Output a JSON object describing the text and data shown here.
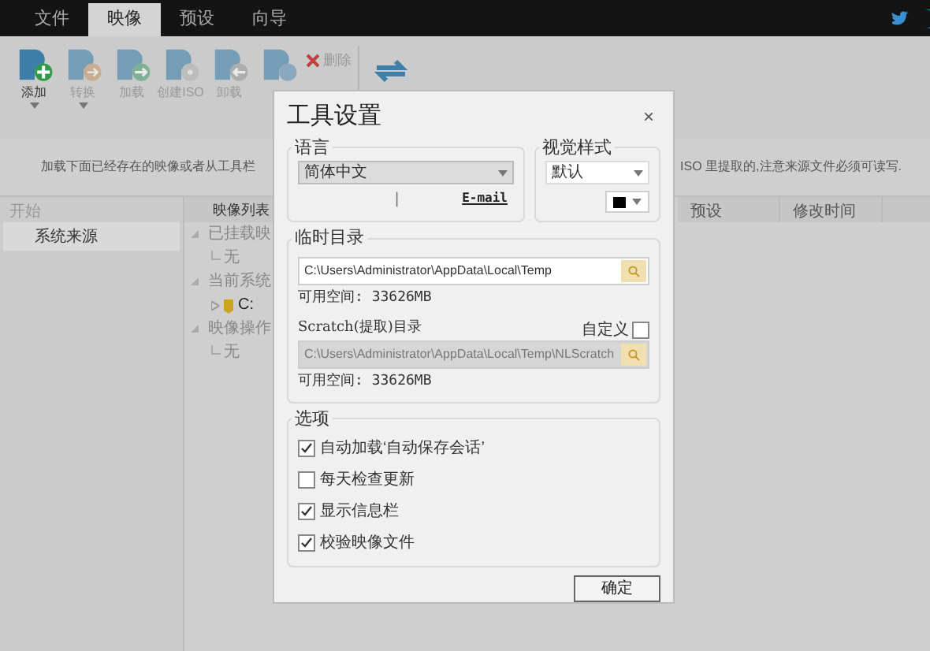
{
  "menu_tabs": [
    {
      "label": "文件",
      "selected": false
    },
    {
      "label": "映像",
      "selected": true
    },
    {
      "label": "预设",
      "selected": false
    },
    {
      "label": "向导",
      "selected": false
    }
  ],
  "toolbar": {
    "buttons": [
      {
        "label": "添加",
        "kind": "add",
        "dropdown": true,
        "disabled": false
      },
      {
        "label": "转换",
        "kind": "convert",
        "dropdown": true,
        "disabled": true
      },
      {
        "label": "加载",
        "kind": "mount",
        "dropdown": false,
        "disabled": true
      },
      {
        "label": "创建ISO",
        "kind": "disc",
        "dropdown": false,
        "disabled": true
      },
      {
        "label": "卸载",
        "kind": "unmount",
        "dropdown": false,
        "disabled": true
      },
      {
        "kind": "new",
        "dropdown": false,
        "disabled": true
      }
    ],
    "delete_label": "删除"
  },
  "info_left": "加载下面已经存在的映像或者从工具栏",
  "info_right": "ISO 里提取的,注意来源文件必须可读写.",
  "sidebar": {
    "header": "开始",
    "items": [
      {
        "label": "系统来源",
        "selected": true
      }
    ]
  },
  "image_list": {
    "header": "映像列表",
    "tree": [
      {
        "label": "已挂载映",
        "children": [
          {
            "label": "无",
            "kind": "text"
          }
        ]
      },
      {
        "label": "当前系统",
        "children": [
          {
            "label": "C:",
            "kind": "drive"
          }
        ]
      },
      {
        "label": "映像操作",
        "children": [
          {
            "label": "无",
            "kind": "text"
          }
        ]
      }
    ]
  },
  "columns": [
    "预设",
    "修改时间"
  ],
  "dialog": {
    "title": "工具设置",
    "close": "×",
    "language": {
      "legend": "语言",
      "value": "简体中文",
      "separator": "|",
      "link": "E-mail"
    },
    "visual_style": {
      "legend": "视觉样式",
      "value": "默认",
      "color": "#000000"
    },
    "temp": {
      "legend": "临时目录",
      "path": "C:\\Users\\Administrator\\AppData\\Local\\Temp",
      "free": "可用空间: 33626MB",
      "scratch_label": "Scratch(提取)目录",
      "custom_label": "自定义",
      "custom_checked": false,
      "scratch_path": "C:\\Users\\Administrator\\AppData\\Local\\Temp\\NLScratch",
      "scratch_disabled": true,
      "scratch_free": "可用空间: 33626MB"
    },
    "options": {
      "legend": "选项",
      "items": [
        {
          "label": "自动加载‘自动保存会话’",
          "checked": true
        },
        {
          "label": "每天检查更新",
          "checked": false
        },
        {
          "label": "显示信息栏",
          "checked": true
        },
        {
          "label": "校验映像文件",
          "checked": true
        }
      ]
    },
    "ok": "确定"
  }
}
